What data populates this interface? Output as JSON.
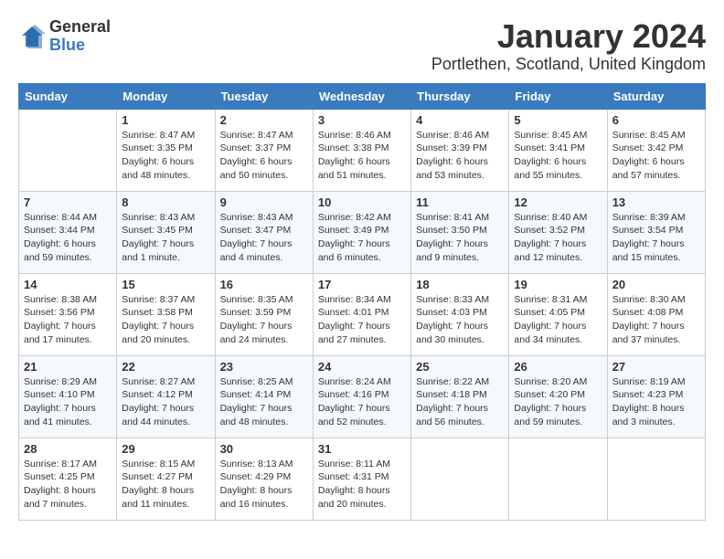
{
  "logo": {
    "general": "General",
    "blue": "Blue"
  },
  "title": "January 2024",
  "location": "Portlethen, Scotland, United Kingdom",
  "days_of_week": [
    "Sunday",
    "Monday",
    "Tuesday",
    "Wednesday",
    "Thursday",
    "Friday",
    "Saturday"
  ],
  "weeks": [
    [
      null,
      {
        "day": 1,
        "sunrise": "8:47 AM",
        "sunset": "3:35 PM",
        "daylight": "6 hours and 48 minutes."
      },
      {
        "day": 2,
        "sunrise": "8:47 AM",
        "sunset": "3:37 PM",
        "daylight": "6 hours and 50 minutes."
      },
      {
        "day": 3,
        "sunrise": "8:46 AM",
        "sunset": "3:38 PM",
        "daylight": "6 hours and 51 minutes."
      },
      {
        "day": 4,
        "sunrise": "8:46 AM",
        "sunset": "3:39 PM",
        "daylight": "6 hours and 53 minutes."
      },
      {
        "day": 5,
        "sunrise": "8:45 AM",
        "sunset": "3:41 PM",
        "daylight": "6 hours and 55 minutes."
      },
      {
        "day": 6,
        "sunrise": "8:45 AM",
        "sunset": "3:42 PM",
        "daylight": "6 hours and 57 minutes."
      }
    ],
    [
      {
        "day": 7,
        "sunrise": "8:44 AM",
        "sunset": "3:44 PM",
        "daylight": "6 hours and 59 minutes."
      },
      {
        "day": 8,
        "sunrise": "8:43 AM",
        "sunset": "3:45 PM",
        "daylight": "7 hours and 1 minute."
      },
      {
        "day": 9,
        "sunrise": "8:43 AM",
        "sunset": "3:47 PM",
        "daylight": "7 hours and 4 minutes."
      },
      {
        "day": 10,
        "sunrise": "8:42 AM",
        "sunset": "3:49 PM",
        "daylight": "7 hours and 6 minutes."
      },
      {
        "day": 11,
        "sunrise": "8:41 AM",
        "sunset": "3:50 PM",
        "daylight": "7 hours and 9 minutes."
      },
      {
        "day": 12,
        "sunrise": "8:40 AM",
        "sunset": "3:52 PM",
        "daylight": "7 hours and 12 minutes."
      },
      {
        "day": 13,
        "sunrise": "8:39 AM",
        "sunset": "3:54 PM",
        "daylight": "7 hours and 15 minutes."
      }
    ],
    [
      {
        "day": 14,
        "sunrise": "8:38 AM",
        "sunset": "3:56 PM",
        "daylight": "7 hours and 17 minutes."
      },
      {
        "day": 15,
        "sunrise": "8:37 AM",
        "sunset": "3:58 PM",
        "daylight": "7 hours and 20 minutes."
      },
      {
        "day": 16,
        "sunrise": "8:35 AM",
        "sunset": "3:59 PM",
        "daylight": "7 hours and 24 minutes."
      },
      {
        "day": 17,
        "sunrise": "8:34 AM",
        "sunset": "4:01 PM",
        "daylight": "7 hours and 27 minutes."
      },
      {
        "day": 18,
        "sunrise": "8:33 AM",
        "sunset": "4:03 PM",
        "daylight": "7 hours and 30 minutes."
      },
      {
        "day": 19,
        "sunrise": "8:31 AM",
        "sunset": "4:05 PM",
        "daylight": "7 hours and 34 minutes."
      },
      {
        "day": 20,
        "sunrise": "8:30 AM",
        "sunset": "4:08 PM",
        "daylight": "7 hours and 37 minutes."
      }
    ],
    [
      {
        "day": 21,
        "sunrise": "8:29 AM",
        "sunset": "4:10 PM",
        "daylight": "7 hours and 41 minutes."
      },
      {
        "day": 22,
        "sunrise": "8:27 AM",
        "sunset": "4:12 PM",
        "daylight": "7 hours and 44 minutes."
      },
      {
        "day": 23,
        "sunrise": "8:25 AM",
        "sunset": "4:14 PM",
        "daylight": "7 hours and 48 minutes."
      },
      {
        "day": 24,
        "sunrise": "8:24 AM",
        "sunset": "4:16 PM",
        "daylight": "7 hours and 52 minutes."
      },
      {
        "day": 25,
        "sunrise": "8:22 AM",
        "sunset": "4:18 PM",
        "daylight": "7 hours and 56 minutes."
      },
      {
        "day": 26,
        "sunrise": "8:20 AM",
        "sunset": "4:20 PM",
        "daylight": "7 hours and 59 minutes."
      },
      {
        "day": 27,
        "sunrise": "8:19 AM",
        "sunset": "4:23 PM",
        "daylight": "8 hours and 3 minutes."
      }
    ],
    [
      {
        "day": 28,
        "sunrise": "8:17 AM",
        "sunset": "4:25 PM",
        "daylight": "8 hours and 7 minutes."
      },
      {
        "day": 29,
        "sunrise": "8:15 AM",
        "sunset": "4:27 PM",
        "daylight": "8 hours and 11 minutes."
      },
      {
        "day": 30,
        "sunrise": "8:13 AM",
        "sunset": "4:29 PM",
        "daylight": "8 hours and 16 minutes."
      },
      {
        "day": 31,
        "sunrise": "8:11 AM",
        "sunset": "4:31 PM",
        "daylight": "8 hours and 20 minutes."
      },
      null,
      null,
      null
    ]
  ],
  "labels": {
    "sunrise": "Sunrise:",
    "sunset": "Sunset:",
    "daylight": "Daylight:"
  }
}
